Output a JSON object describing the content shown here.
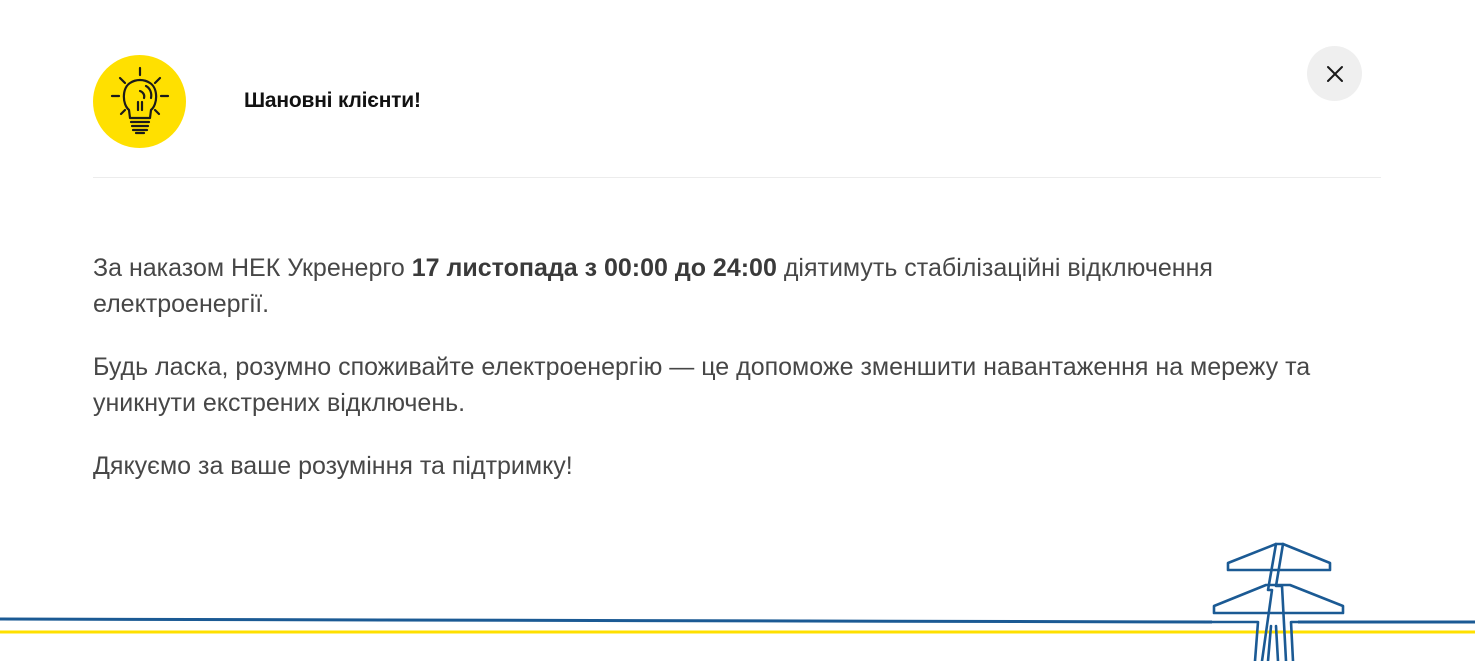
{
  "modal": {
    "title": "Шановні клієнти!",
    "close_label": "Закрити",
    "icon": "lightbulb-icon",
    "accent_color": "#ffe000",
    "line_colors": {
      "blue": "#1b5a94",
      "yellow": "#ffe000"
    }
  },
  "message": {
    "p1_pre": "За наказом НЕК Укренерго ",
    "p1_bold": "17 листопада з 00:00 до 24:00",
    "p1_post": " діятимуть стабілізаційні відключення електроенергії.",
    "p2": "Будь ласка, розумно споживайте електроенергію — це допоможе зменшити навантаження на мережу та уникнути екстрених відключень.",
    "p3": "Дякуємо за ваше розуміння та підтримку!"
  }
}
